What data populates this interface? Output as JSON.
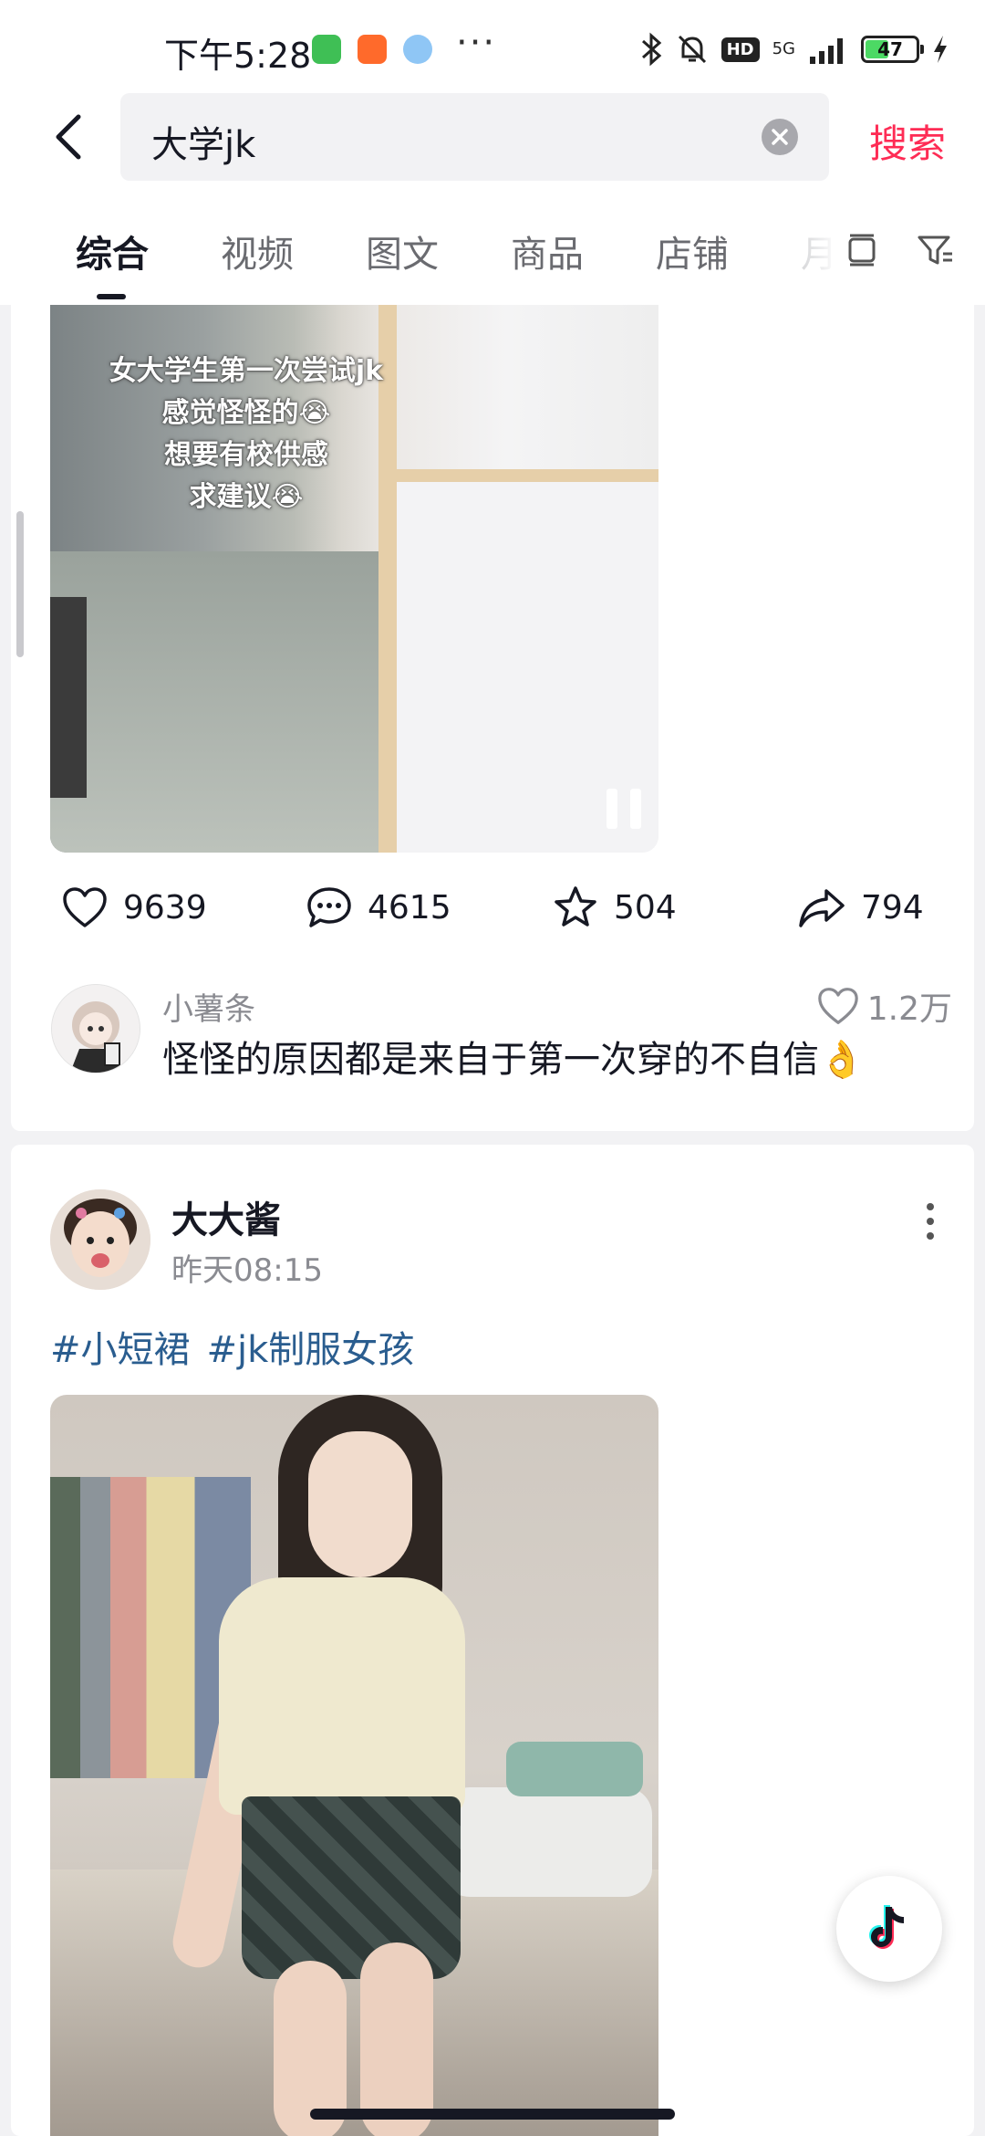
{
  "status_bar": {
    "time": "下午5:28",
    "network": "5G",
    "battery": "47",
    "battery_level": 0.47,
    "hd": "HD",
    "overflow": "···"
  },
  "search": {
    "query": "大学jk",
    "submit_label": "搜索"
  },
  "tabs": [
    {
      "label": "综合",
      "active": true
    },
    {
      "label": "视频",
      "active": false
    },
    {
      "label": "图文",
      "active": false
    },
    {
      "label": "商品",
      "active": false
    },
    {
      "label": "店铺",
      "active": false
    },
    {
      "label": "月",
      "active": false
    }
  ],
  "post1": {
    "video_caption": [
      "女大学生第一次尝试jk",
      "感觉怪怪的😭",
      "想要有校供感",
      "求建议😭"
    ],
    "stats": {
      "likes": "9639",
      "comments": "4615",
      "favorites": "504",
      "shares": "794"
    },
    "top_comment": {
      "author": "小薯条",
      "likes": "1.2万",
      "text": "怪怪的原因都是来自于第一次穿的不自信👌"
    }
  },
  "post2": {
    "author": "大大酱",
    "time": "昨天08:15",
    "hashtags": [
      "#小短裙",
      "#jk制服女孩"
    ]
  },
  "colors": {
    "accent": "#fe2c55",
    "hashtag": "#2a5d8f",
    "text": "#161823",
    "secondary": "#8a8b91"
  },
  "icons": [
    "back-arrow-icon",
    "clear-icon",
    "layout-icon",
    "filter-icon",
    "heart-icon",
    "comment-icon",
    "star-icon",
    "share-icon",
    "pause-icon",
    "more-icon",
    "douyin-logo-icon"
  ]
}
